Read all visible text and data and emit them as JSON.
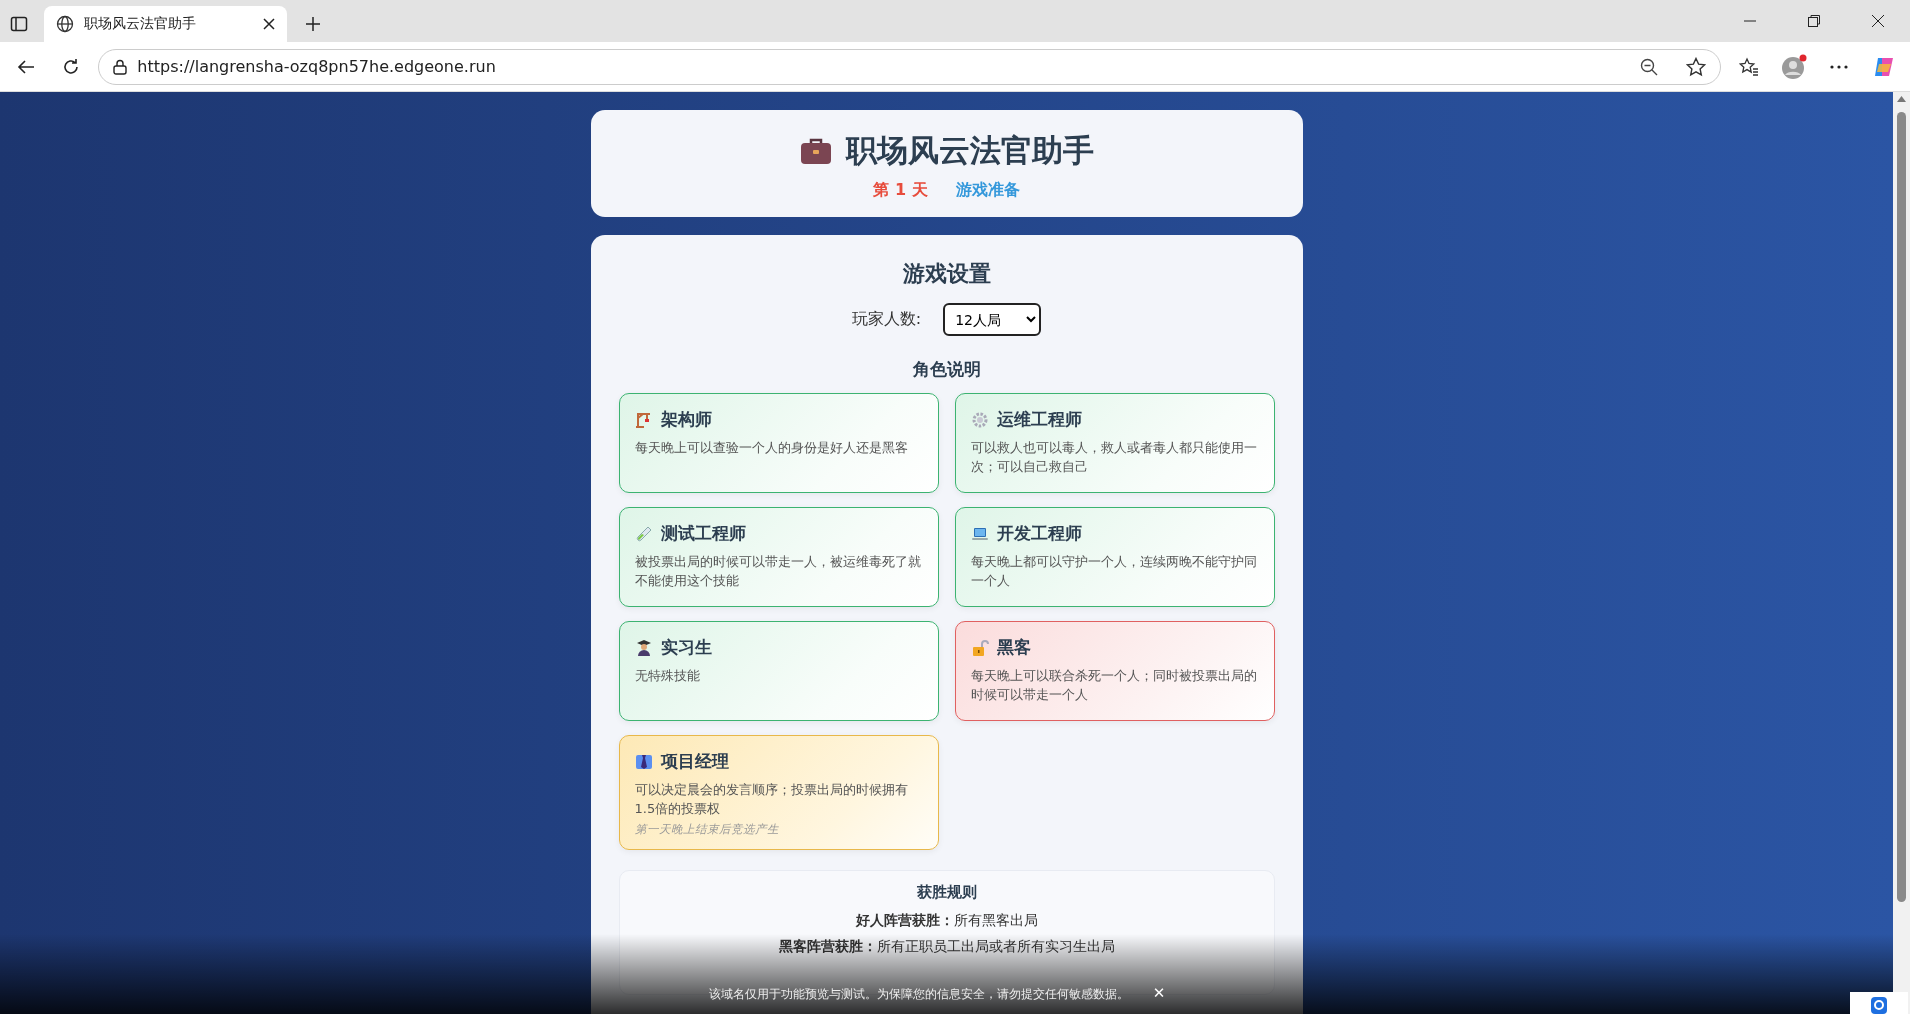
{
  "browser": {
    "tab_title": "职场风云法官助手",
    "url": "https://langrensha-ozq8pn57he.edgeone.run"
  },
  "header": {
    "title": "职场风云法官助手",
    "day": "第 1 天",
    "phase": "游戏准备"
  },
  "settings": {
    "title": "游戏设置",
    "player_count_label": "玩家人数:",
    "player_count": "12人局"
  },
  "roles": {
    "title": "角色说明",
    "cards": [
      {
        "kind": "good",
        "name": "架构师",
        "description": "每天晚上可以查验一个人的身份是好人还是黑客"
      },
      {
        "kind": "good",
        "name": "运维工程师",
        "description": "可以救人也可以毒人，救人或者毒人都只能使用一次；可以自己救自己"
      },
      {
        "kind": "good",
        "name": "测试工程师",
        "description": "被投票出局的时候可以带走一人，被运维毒死了就不能使用这个技能"
      },
      {
        "kind": "good",
        "name": "开发工程师",
        "description": "每天晚上都可以守护一个人，连续两晚不能守护同一个人"
      },
      {
        "kind": "good",
        "name": "实习生",
        "description": "无特殊技能"
      },
      {
        "kind": "hacker",
        "name": "黑客",
        "description": "每天晚上可以联合杀死一个人；同时被投票出局的时候可以带走一个人"
      },
      {
        "kind": "leader",
        "name": "项目经理",
        "description": "可以决定晨会的发言顺序；投票出局的时候拥有1.5倍的投票权",
        "note": "第一天晚上结束后竞选产生"
      }
    ]
  },
  "win_rules": {
    "title": "获胜规则",
    "rules": [
      "**好人阵营获胜：**所有黑客出局",
      "**黑客阵营获胜：**所有正职员工出局或者所有实习生出局"
    ]
  },
  "notice": {
    "text": "该域名仅用于功能预览与测试。为保障您的信息安全，请勿提交任何敏感数据。",
    "close": "✕"
  }
}
